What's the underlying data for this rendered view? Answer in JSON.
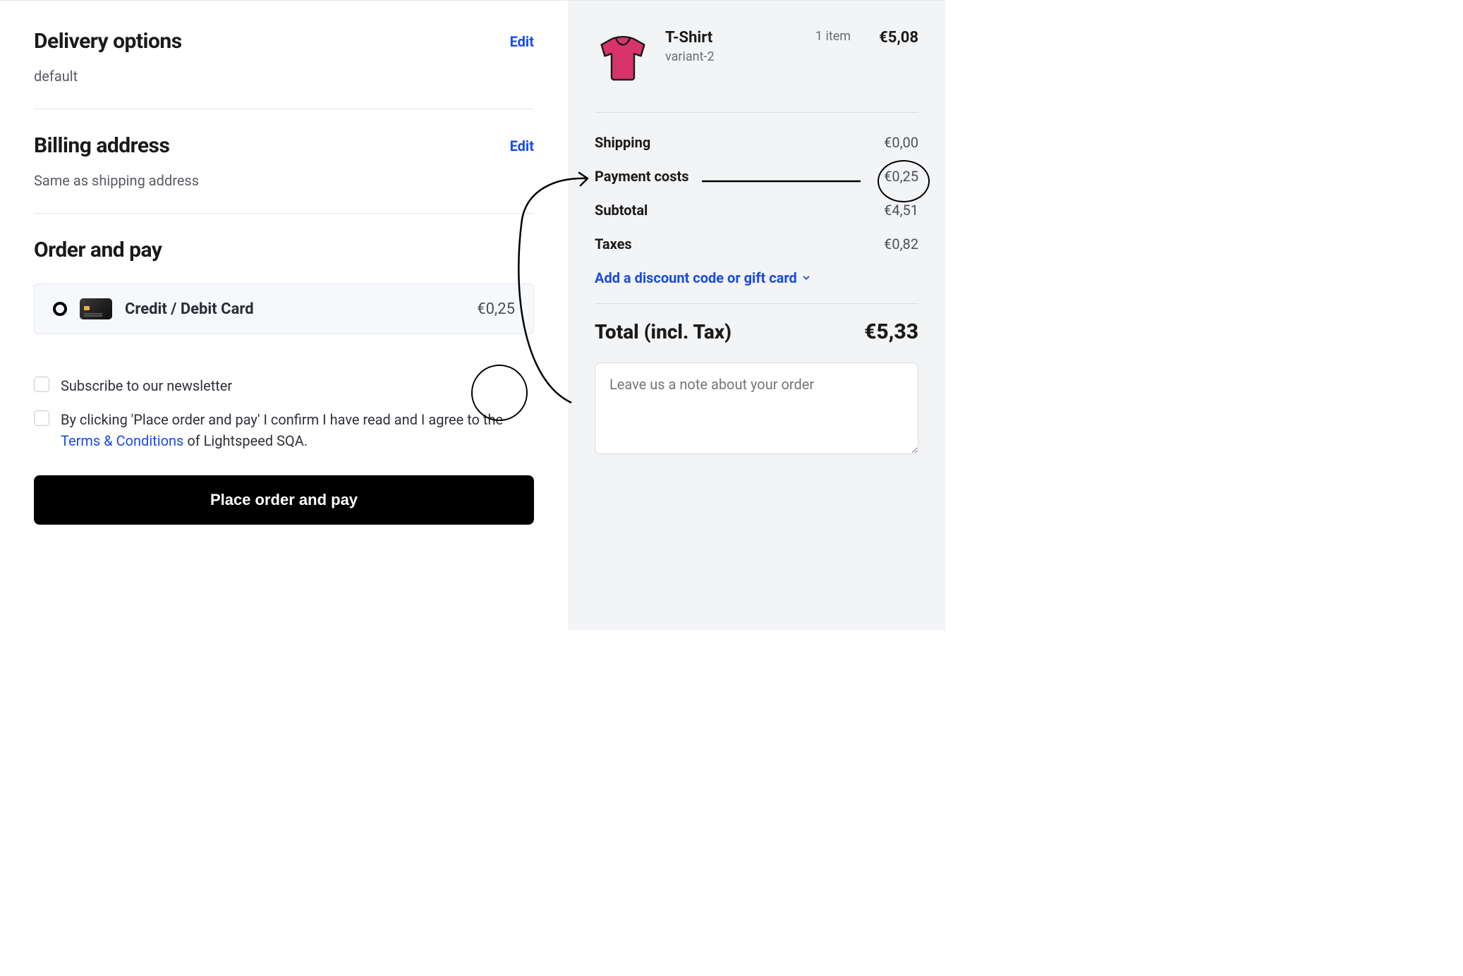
{
  "delivery": {
    "title": "Delivery options",
    "edit": "Edit",
    "value": "default"
  },
  "billing": {
    "title": "Billing address",
    "edit": "Edit",
    "value": "Same as shipping address"
  },
  "order": {
    "title": "Order and pay",
    "payment_method": {
      "label": "Credit / Debit Card",
      "price": "€0,25"
    },
    "newsletter_label": "Subscribe to our newsletter",
    "agree_prefix": "By clicking 'Place order and pay' I confirm I have read and I agree to the ",
    "terms_link_text": "Terms & Conditions",
    "agree_suffix": " of Lightspeed SQA.",
    "place_order_button": "Place order and pay"
  },
  "cart": {
    "item": {
      "name": "T-Shirt",
      "variant": "variant-2",
      "qty": "1 item",
      "price": "€5,08"
    },
    "shipping_label": "Shipping",
    "shipping_value": "€0,00",
    "payment_costs_label": "Payment costs",
    "payment_costs_value": "€0,25",
    "subtotal_label": "Subtotal",
    "subtotal_value": "€4,51",
    "taxes_label": "Taxes",
    "taxes_value": "€0,82",
    "discount_link": "Add a discount code or gift card",
    "total_label": "Total (incl. Tax)",
    "total_value": "€5,33",
    "note_placeholder": "Leave us a note about your order"
  }
}
